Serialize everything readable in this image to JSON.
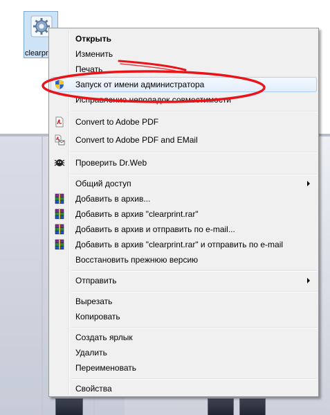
{
  "desktop": {
    "icon_label": "clearpr",
    "icon_name": "settings-file-icon"
  },
  "menu": {
    "items": [
      {
        "label": "Открыть",
        "bold": true
      },
      {
        "label": "Изменить"
      },
      {
        "label": "Печать"
      },
      {
        "label": "Запуск от имени администратора",
        "icon": "uac-shield-icon",
        "highlighted": true
      },
      {
        "label": "Исправление неполадок совместимости"
      },
      {
        "label": "Convert to Adobe PDF",
        "icon": "adobe-pdf-icon"
      },
      {
        "label": "Convert to Adobe PDF and EMail",
        "icon": "adobe-pdf-email-icon"
      },
      {
        "label": "Проверить Dr.Web",
        "icon": "drweb-icon"
      },
      {
        "label": "Общий доступ",
        "submenu": true
      },
      {
        "label": "Добавить в архив...",
        "icon": "winrar-icon"
      },
      {
        "label": "Добавить в архив \"clearprint.rar\"",
        "icon": "winrar-icon"
      },
      {
        "label": "Добавить в архив и отправить по e-mail...",
        "icon": "winrar-icon"
      },
      {
        "label": "Добавить в архив \"clearprint.rar\" и отправить по e-mail",
        "icon": "winrar-icon"
      },
      {
        "label": "Восстановить прежнюю версию"
      },
      {
        "label": "Отправить",
        "submenu": true
      },
      {
        "label": "Вырезать"
      },
      {
        "label": "Копировать"
      },
      {
        "label": "Создать ярлык"
      },
      {
        "label": "Удалить"
      },
      {
        "label": "Переименовать"
      },
      {
        "label": "Свойства"
      }
    ]
  },
  "colors": {
    "annotation": "#e8141a",
    "highlight_border": "#aecff7"
  }
}
